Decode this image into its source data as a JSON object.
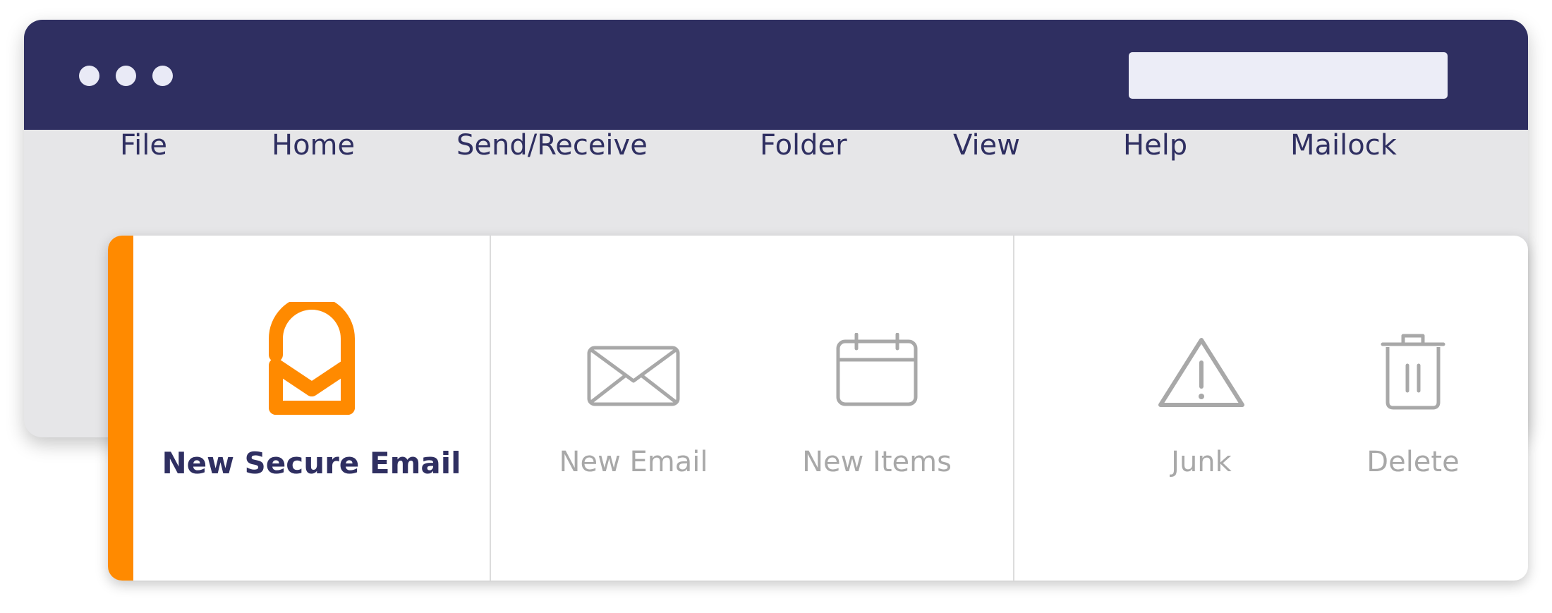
{
  "window": {
    "search": {
      "value": "",
      "placeholder": ""
    },
    "menu": [
      {
        "label": "File"
      },
      {
        "label": "Home"
      },
      {
        "label": "Send/Receive"
      },
      {
        "label": "Folder"
      },
      {
        "label": "View"
      },
      {
        "label": "Help"
      },
      {
        "label": "Mailock"
      }
    ]
  },
  "ribbon": {
    "tools": [
      {
        "label": "New Secure Email",
        "icon": "mailock-logo-icon"
      },
      {
        "label": "New Email",
        "icon": "envelope-icon"
      },
      {
        "label": "New Items",
        "icon": "calendar-icon"
      },
      {
        "label": "Junk",
        "icon": "warning-icon"
      },
      {
        "label": "Delete",
        "icon": "trash-icon"
      }
    ]
  },
  "colors": {
    "titlebar": "#2f2f61",
    "menubar": "#e6e6e8",
    "accent": "#ff8a00",
    "text_primary": "#2f2f61",
    "text_muted": "#a8a8a8"
  }
}
